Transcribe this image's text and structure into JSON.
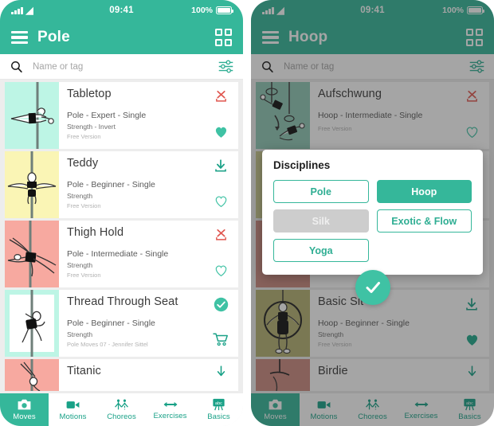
{
  "theme": {
    "teal": "#35b79a",
    "teal_dark": "#19a187",
    "red": "#e0564f",
    "list_bg": "#ededed",
    "fab_green": "#3fc2a4"
  },
  "status_bar": {
    "time": "09:41",
    "battery": "100%",
    "signal_icon": "signal-bars-icon",
    "wifi_icon": "wifi-icon",
    "battery_icon": "battery-icon"
  },
  "search": {
    "placeholder": "Name or tag",
    "value": "",
    "search_icon": "search-icon",
    "filter_icon": "filter-sliders-icon"
  },
  "bottom_nav": {
    "items": [
      {
        "label": "Moves",
        "icon": "camera-icon",
        "active": true
      },
      {
        "label": "Motions",
        "icon": "video-camera-icon",
        "active": false
      },
      {
        "label": "Choreos",
        "icon": "choreography-icon",
        "active": false
      },
      {
        "label": "Exercises",
        "icon": "arrows-horizontal-icon",
        "active": false
      },
      {
        "label": "Basics",
        "icon": "chalkboard-abc-icon",
        "active": false
      }
    ]
  },
  "phones": [
    {
      "name": "pole-screen",
      "appbar": {
        "title": "Pole",
        "menu_icon": "hamburger-menu-icon",
        "grid_icon": "grid-view-icon"
      },
      "dimmed": false,
      "cards": [
        {
          "title": "Tabletop",
          "meta": "Pole - Expert - Single",
          "tags": "Strength - Invert",
          "source": "Free Version",
          "thumb_color": "#bdf5e5",
          "thumb_art": "pole-horizontal-hold",
          "top_icon": "delete-download-icon",
          "bottom_icon": "heart-filled-icon"
        },
        {
          "title": "Teddy",
          "meta": "Pole - Beginner - Single",
          "tags": "Strength",
          "source": "Free Version",
          "thumb_color": "#faf5b5",
          "thumb_art": "pole-straddle",
          "top_icon": "download-icon",
          "bottom_icon": "heart-outline-icon"
        },
        {
          "title": "Thigh Hold",
          "meta": "Pole - Intermediate - Single",
          "tags": "Strength",
          "source": "Free Version",
          "thumb_color": "#f7a9a0",
          "thumb_art": "pole-thigh-hold",
          "top_icon": "delete-download-icon",
          "bottom_icon": "heart-outline-icon"
        },
        {
          "title": "Thread Through Seat",
          "meta": "Pole - Beginner - Single",
          "tags": "Strength",
          "source": "Pole Moves 07 - Jennifer Sittel",
          "thumb_color": "#bdf5e5",
          "thumb_art": "pole-thread-seat",
          "top_icon": "check-circle-icon",
          "bottom_icon": "shopping-cart-icon"
        },
        {
          "title": "Titanic",
          "meta": "",
          "tags": "",
          "source": "",
          "thumb_color": "#f7a9a0",
          "thumb_art": "pole-titanic",
          "top_icon": "download-arrow-icon",
          "bottom_icon": ""
        }
      ]
    },
    {
      "name": "hoop-screen",
      "appbar": {
        "title": "Hoop",
        "menu_icon": "hamburger-menu-icon",
        "grid_icon": "grid-view-icon"
      },
      "dimmed": true,
      "cards": [
        {
          "title": "Aufschwung",
          "meta": "Hoop - Intermediate - Single",
          "tags": "",
          "source": "Free Version",
          "thumb_color": "#8fc9b6",
          "thumb_art": "hoop-aufschwung",
          "top_icon": "delete-download-icon",
          "bottom_icon": "heart-outline-icon"
        },
        {
          "title": "Basic Sit",
          "meta": "Hoop - Beginner - Single",
          "tags": "Strength",
          "source": "Free Version",
          "thumb_color": "#b6b173",
          "thumb_art": "hoop-basic-sit",
          "top_icon": "download-icon",
          "bottom_icon": "heart-filled-icon"
        },
        {
          "title": "Birdie",
          "meta": "",
          "tags": "",
          "source": "",
          "thumb_color": "#cc8b80",
          "thumb_art": "hoop-birdie",
          "top_icon": "download-arrow-icon",
          "bottom_icon": ""
        }
      ],
      "modal": {
        "title": "Disciplines",
        "options": [
          {
            "label": "Pole",
            "state": "normal"
          },
          {
            "label": "Hoop",
            "state": "selected"
          },
          {
            "label": "Silk",
            "state": "disabled"
          },
          {
            "label": "Exotic & Flow",
            "state": "normal"
          },
          {
            "label": "Yoga",
            "state": "normal"
          }
        ],
        "confirm_icon": "check-icon"
      }
    }
  ]
}
